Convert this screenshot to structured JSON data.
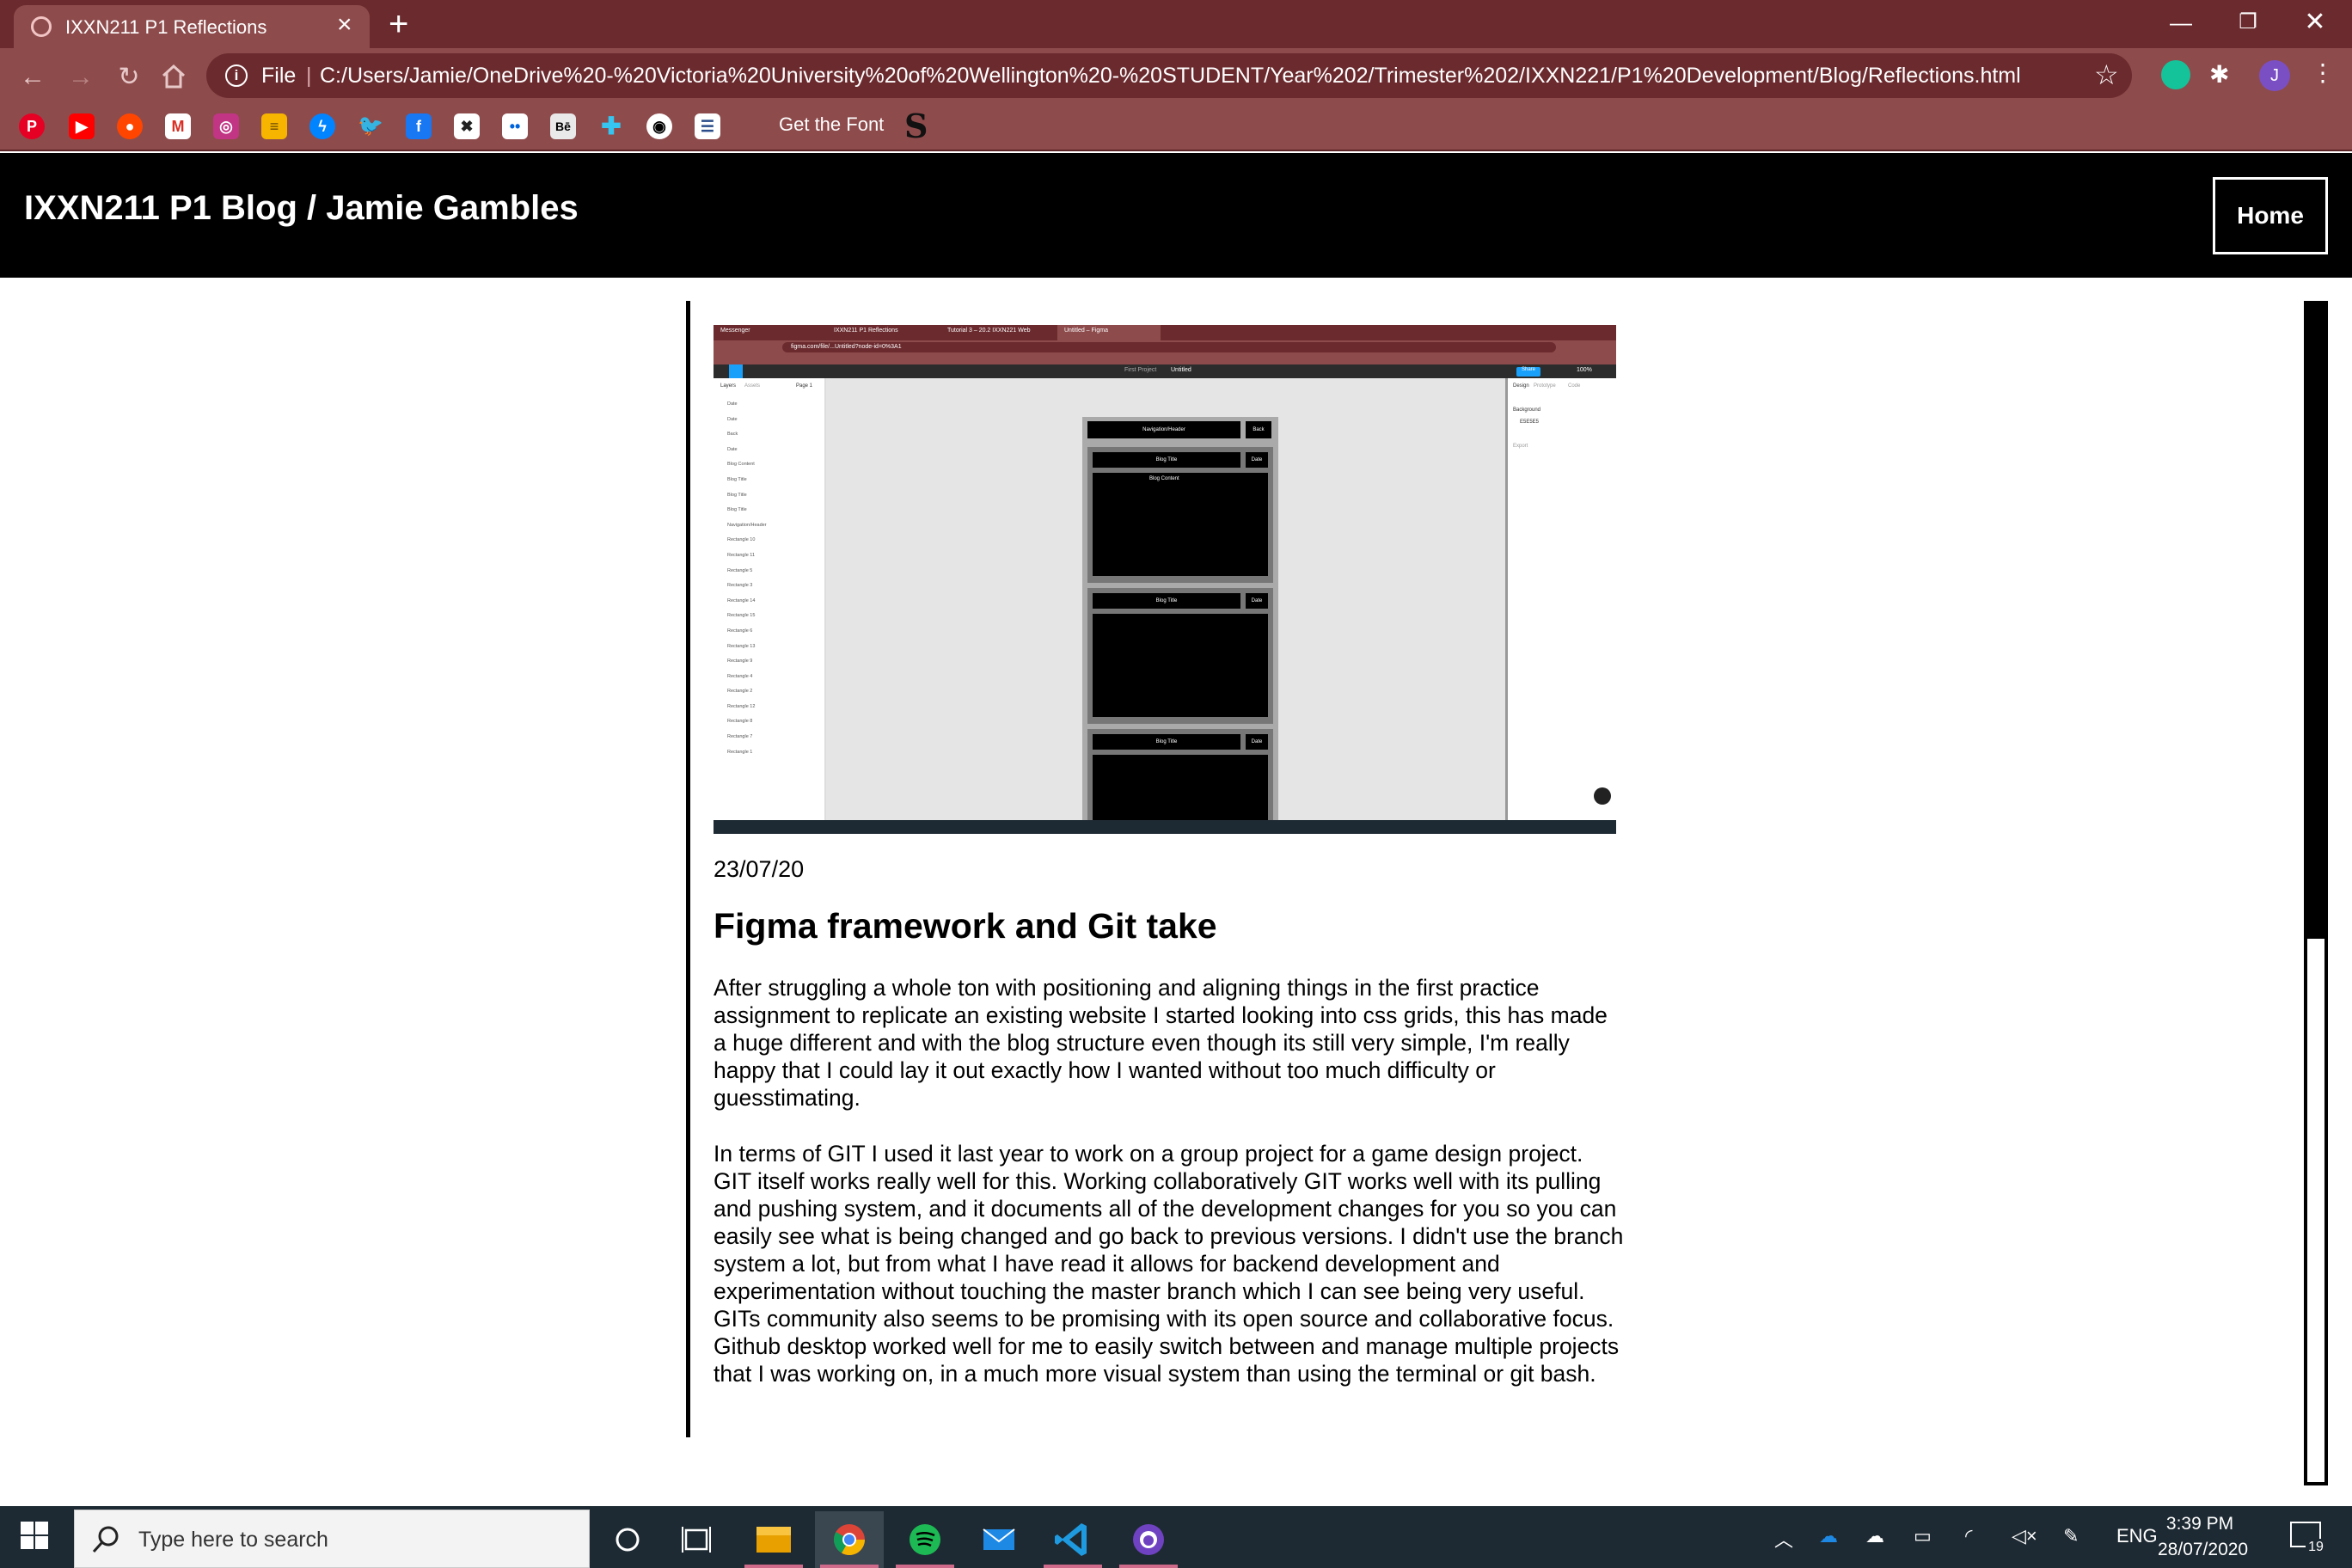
{
  "browser": {
    "tab_title": "IXXN211 P1 Reflections",
    "tab_close": "×",
    "new_tab": "+",
    "address_prefix": "File",
    "url": "C:/Users/Jamie/OneDrive%20-%20Victoria%20University%20of%20Wellington%20-%20STUDENT/Year%202/Trimester%202/IXXN221/P1%20Development/Blog/Reflections.html",
    "profile_initial": "J",
    "bookmark_text": "Get the Font",
    "bookmark_letter": "S"
  },
  "site": {
    "title": "IXXN211 P1 Blog / Jamie Gambles",
    "home_label": "Home"
  },
  "post": {
    "date": "23/07/20",
    "title": "Figma framework and Git take",
    "paragraph1": "After struggling a whole ton with positioning and aligning things in the first practice assignment to replicate an existing website I started looking into css grids, this has made a huge different and with the blog structure even though its still very simple, I'm really happy that I could lay it out exactly how I wanted without too much difficulty or guesstimating.",
    "paragraph2": "In terms of GIT I used it last year to work on a group project for a game design project. GIT itself works really well for this. Working collaboratively GIT works well with its pulling and pushing system, and it documents all of the development changes for you so you can easily see what is being changed and go back to previous versions. I didn't use the branch system a lot, but from what I have read it allows for backend development and experimentation without touching the master branch which I can see being very useful. GITs community also seems to be promising with its open source and collaborative focus. Github desktop worked well for me to easily switch between and manage multiple projects that I was working on, in a much more visual system than using the terminal or git bash."
  },
  "figma": {
    "tabs": [
      "Messenger",
      "IXXN211 P1 Reflections",
      "Tutorial 3 – 20.2 IXXN221 Web",
      "Untitled – Figma"
    ],
    "url": "figma.com/file/...Untitled?node-id=0%3A1",
    "project": "First Project",
    "file": "Untitled",
    "share": "Share",
    "zoom": "100%",
    "panel_tabs": [
      "Layers",
      "Assets",
      "Page 1"
    ],
    "right_tabs": [
      "Design",
      "Prototype",
      "Code"
    ],
    "background_label": "Background",
    "background_value": "E5E5E5",
    "export_label": "Export",
    "layers": [
      "Date",
      "Date",
      "Back",
      "Date",
      "Blog Content",
      "Blog Title",
      "Blog Title",
      "Blog Title",
      "Navigation/Header",
      "Rectangle 10",
      "Rectangle 11",
      "Rectangle 5",
      "Rectangle 3",
      "Rectangle 14",
      "Rectangle 15",
      "Rectangle 6",
      "Rectangle 13",
      "Rectangle 9",
      "Rectangle 4",
      "Rectangle 2",
      "Rectangle 12",
      "Rectangle 8",
      "Rectangle 7",
      "Rectangle 1"
    ],
    "nav_label": "Navigation/Header",
    "back_label": "Back",
    "blog_title_label": "Blog Title",
    "date_label": "Date",
    "blog_content_label": "Blog Content"
  },
  "taskbar": {
    "search_placeholder": "Type here to search",
    "language": "ENG",
    "time": "3:39 PM",
    "date": "28/07/2020",
    "notifications": "19"
  }
}
